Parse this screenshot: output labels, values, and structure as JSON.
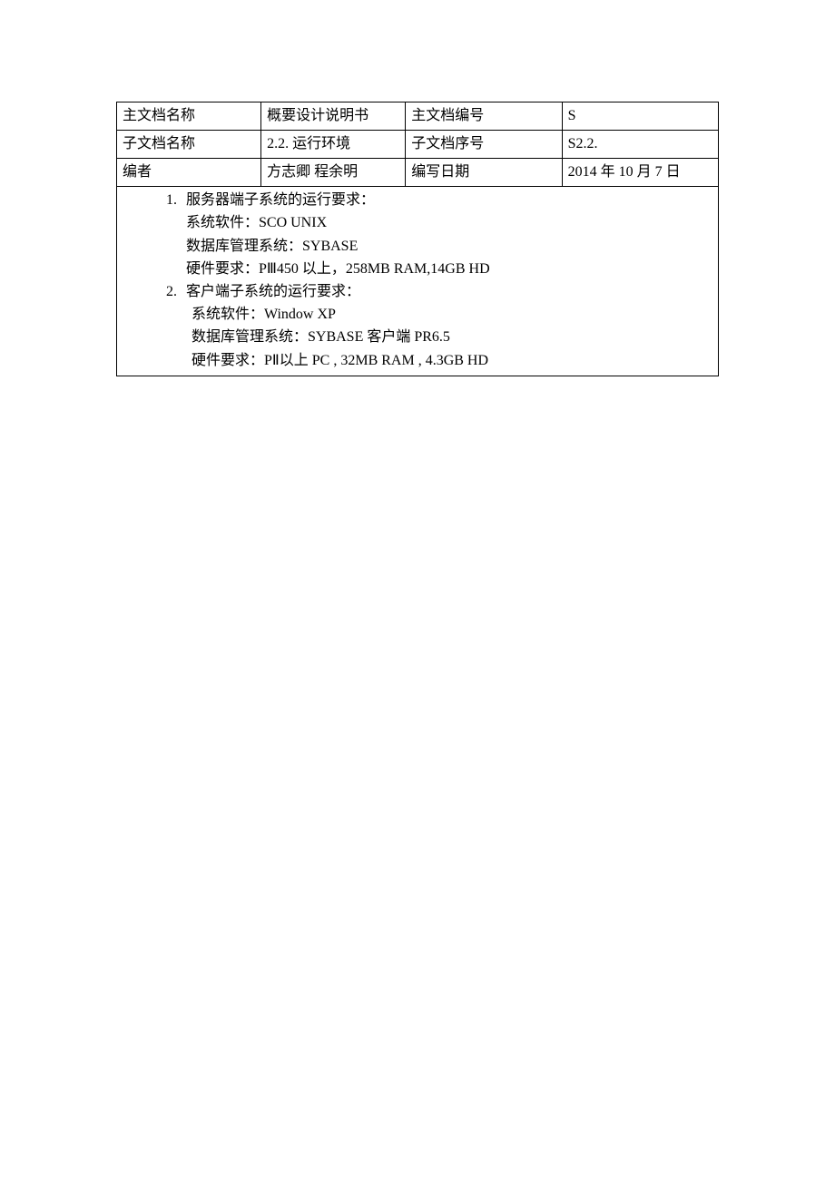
{
  "header": {
    "row1": {
      "label1": "主文档名称",
      "value1": "概要设计说明书",
      "label2": "主文档编号",
      "value2": "S"
    },
    "row2": {
      "label1": "子文档名称",
      "value1": "2.2. 运行环境",
      "label2": "子文档序号",
      "value2": "S2.2."
    },
    "row3": {
      "label1": "编者",
      "value1": "方志卿  程余明",
      "label2": "编写日期",
      "value2": "2014 年 10 月  7 日"
    }
  },
  "content": {
    "item1": {
      "marker": "1.",
      "title": "服务器端子系统的运行要求：",
      "lines": [
        "系统软件：SCO    UNIX",
        "数据库管理系统：SYBASE",
        "硬件要求：PⅢ450 以上，258MB RAM,14GB HD"
      ]
    },
    "item2": {
      "marker": "2.",
      "title": "客户端子系统的运行要求：",
      "lines": [
        "系统软件：Window XP",
        "数据库管理系统：SYBASE 客户端 PR6.5",
        "硬件要求：PⅡ以上 PC , 32MB    RAM , 4.3GB HD"
      ]
    }
  }
}
